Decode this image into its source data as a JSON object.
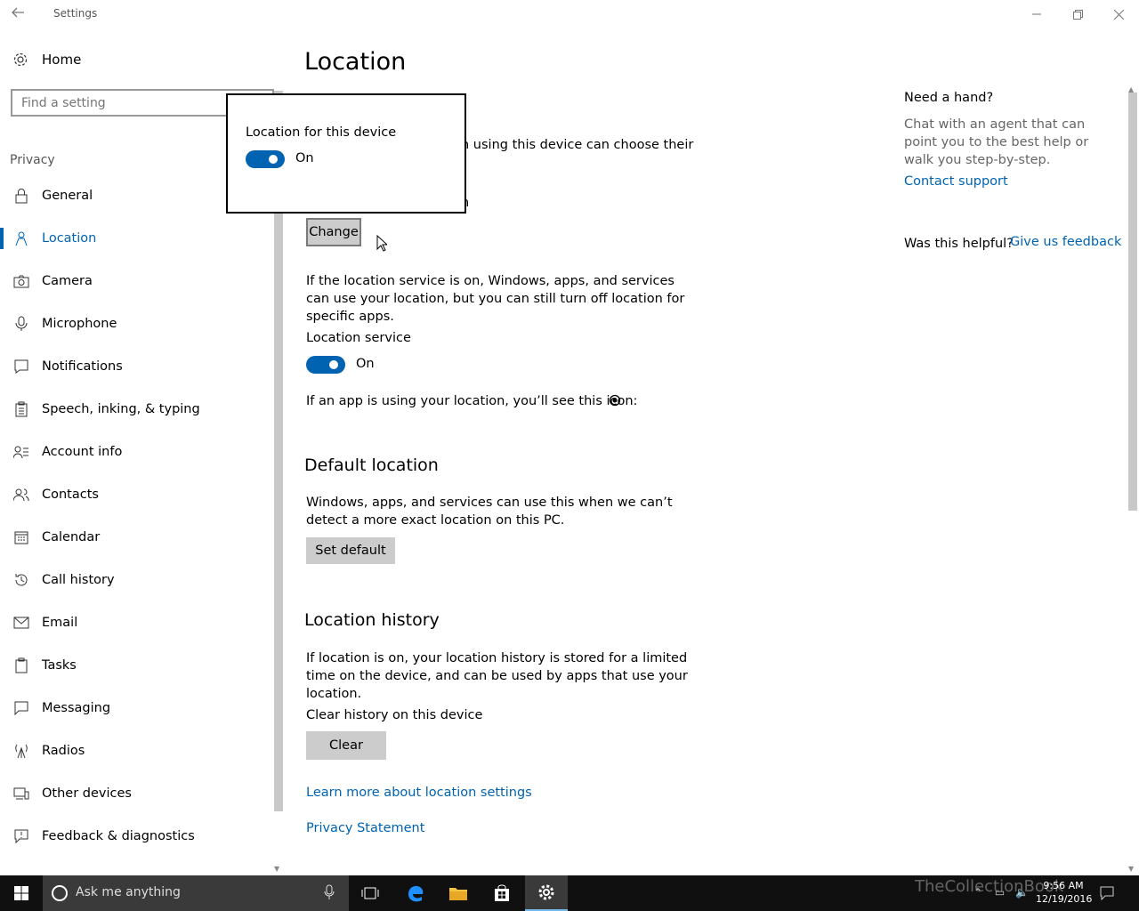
{
  "window": {
    "title": "Settings",
    "back_icon": "back-arrow-icon",
    "minimize_icon": "minimize-icon",
    "restore_icon": "restore-icon",
    "close_icon": "close-icon"
  },
  "sidebar": {
    "home_label": "Home",
    "search_placeholder": "Find a setting",
    "section_label": "Privacy",
    "items": [
      {
        "label": "General",
        "icon": "lock-icon"
      },
      {
        "label": "Location",
        "icon": "location-person-icon",
        "active": true
      },
      {
        "label": "Camera",
        "icon": "camera-icon"
      },
      {
        "label": "Microphone",
        "icon": "microphone-icon"
      },
      {
        "label": "Notifications",
        "icon": "notification-icon"
      },
      {
        "label": "Speech, inking, & typing",
        "icon": "clipboard-icon"
      },
      {
        "label": "Account info",
        "icon": "account-info-icon"
      },
      {
        "label": "Contacts",
        "icon": "contacts-icon"
      },
      {
        "label": "Calendar",
        "icon": "calendar-icon"
      },
      {
        "label": "Call history",
        "icon": "history-icon"
      },
      {
        "label": "Email",
        "icon": "email-icon"
      },
      {
        "label": "Tasks",
        "icon": "tasks-icon"
      },
      {
        "label": "Messaging",
        "icon": "message-icon"
      },
      {
        "label": "Radios",
        "icon": "radio-icon"
      },
      {
        "label": "Other devices",
        "icon": "devices-icon"
      },
      {
        "label": "Feedback & diagnostics",
        "icon": "feedback-icon"
      }
    ]
  },
  "main": {
    "title": "Location",
    "partial_text_1": "n using this device can choose their",
    "partial_text_2": "n",
    "change_button": "Change",
    "service_description": "If the location service is on, Windows, apps, and services can use your location, but you can still turn off location for specific apps.",
    "service_label": "Location service",
    "service_state": "On",
    "icon_text": "If an app is using your location, you’ll see this icon:",
    "default_heading": "Default location",
    "default_description": "Windows, apps, and services can use this when we can’t detect a more exact location on this PC.",
    "set_default_button": "Set default",
    "history_heading": "Location history",
    "history_description": "If location is on, your location history is stored for a limited time on the device, and can be used by apps that use your location.",
    "clear_label": "Clear history on this device",
    "clear_button": "Clear",
    "learn_more_link": "Learn more about location settings",
    "privacy_link": "Privacy Statement"
  },
  "help": {
    "title": "Need a hand?",
    "description": "Chat with an agent that can point you to the best help or walk you step-by-step.",
    "contact_link": "Contact support",
    "helpful_label": "Was this helpful?",
    "feedback_link": "Give us feedback"
  },
  "popup": {
    "title": "Location for this device",
    "state": "On"
  },
  "taskbar": {
    "search_placeholder": "Ask me anything",
    "time": "9:56 AM",
    "date": "12/19/2016",
    "watermark": "TheCollectionBook"
  },
  "colors": {
    "accent": "#0063b1",
    "button_bg": "#cccccc",
    "taskbar_bg": "#101010"
  }
}
